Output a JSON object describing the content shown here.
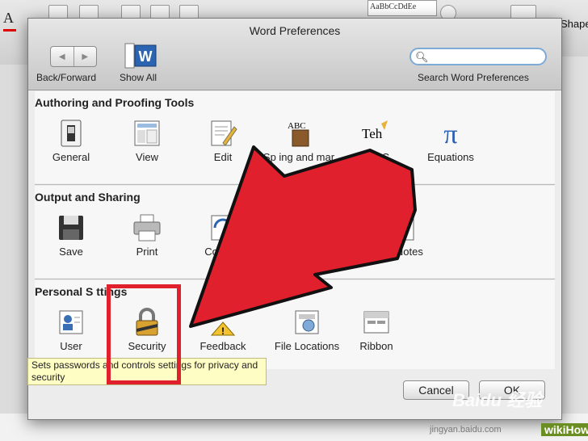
{
  "background_app": {
    "font_preview": "AaBbCcDdEe",
    "shape_label": "Shape"
  },
  "dialog": {
    "title": "Word Preferences",
    "toolbar": {
      "back_forward_label": "Back/Forward",
      "show_all_label": "Show All",
      "search_caption": "Search Word Preferences",
      "search_value": ""
    },
    "sections": [
      {
        "title": "Authoring and Proofing Tools",
        "items": [
          {
            "label": "General",
            "icon": "switch-icon"
          },
          {
            "label": "View",
            "icon": "view-icon"
          },
          {
            "label": "Edit",
            "icon": "edit-icon"
          },
          {
            "label": "Sp ing and mar",
            "icon": "spelling-icon"
          },
          {
            "label": "AutoC",
            "icon": "autocorrect-icon"
          },
          {
            "label": "Equations",
            "icon": "pi-icon"
          }
        ]
      },
      {
        "title": "Output and Sharing",
        "items": [
          {
            "label": "Save",
            "icon": "floppy-icon"
          },
          {
            "label": "Print",
            "icon": "printer-icon"
          },
          {
            "label": "Compat",
            "icon": "compatibility-icon"
          },
          {
            "label": "io Notes",
            "icon": "audio-notes-icon"
          }
        ]
      },
      {
        "title": "Personal S ttings",
        "items": [
          {
            "label": "User",
            "icon": "user-icon"
          },
          {
            "label": "Security",
            "icon": "lock-icon"
          },
          {
            "label": "Feedback",
            "icon": "feedback-icon"
          },
          {
            "label": "File Locations",
            "icon": "file-locations-icon"
          },
          {
            "label": "Ribbon",
            "icon": "ribbon-icon"
          }
        ]
      }
    ],
    "tooltip": "Sets passwords and controls settings for privacy and security",
    "buttons": {
      "cancel": "Cancel",
      "ok": "OK"
    }
  },
  "watermark": {
    "baidu": "Baidu 经验",
    "url": "jingyan.baidu.com",
    "wikihow": "wikiHow"
  },
  "colors": {
    "annotation_red": "#e0202c",
    "tooltip_bg": "#fefdc4",
    "search_border": "#7eaad6"
  }
}
